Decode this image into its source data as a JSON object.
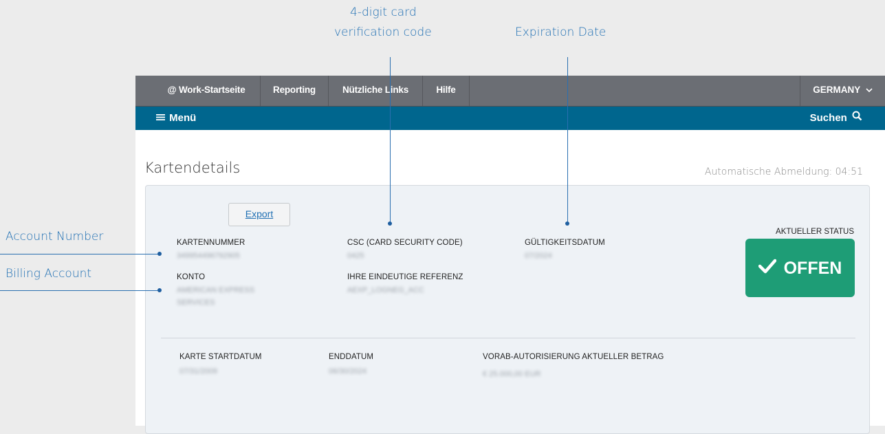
{
  "callouts": {
    "cvc_line1": "4-digit card",
    "cvc_line2": "verification code",
    "expiration": "Expiration Date",
    "account_number": "Account Number",
    "billing_account": "Billing Account"
  },
  "topnav": {
    "items": [
      "@ Work-Startseite",
      "Reporting",
      "Nützliche Links",
      "Hilfe"
    ],
    "country": "GERMANY",
    "country_icon": "chevron-down-icon"
  },
  "menubar": {
    "menu_label": "Menü",
    "menu_icon": "hamburger-icon",
    "search_label": "Suchen",
    "search_icon": "search-icon"
  },
  "auto_logout": "Automatische Abmeldung: 04:51",
  "page_title": "Kartendetails",
  "export_label": "Export",
  "fields": {
    "card_number": {
      "label": "KARTENNUMMER",
      "value": "349954496792905"
    },
    "account": {
      "label": "KONTO",
      "value_line1": "AMERICAN EXPRESS",
      "value_line2": "SERVICES"
    },
    "csc": {
      "label": "CSC (CARD SECURITY CODE)",
      "value": "0425"
    },
    "reference": {
      "label": "IHRE EINDEUTIGE REFERENZ",
      "value": "AEXP_LOGNEG_ACC"
    },
    "expiry": {
      "label": "GÜLTIGKEITSDATUM",
      "value": "07/2024"
    },
    "start_date": {
      "label": "KARTE STARTDATUM",
      "value": "07/31/2009"
    },
    "end_date": {
      "label": "ENDDATUM",
      "value": "06/30/2024"
    },
    "preauth": {
      "label": "VORAB-AUTORISIERUNG AKTUELLER BETRAG",
      "value": "€ 25.000,00 EUR"
    }
  },
  "status": {
    "label": "AKTUELLER STATUS",
    "value": "OFFEN",
    "icon": "checkmark-icon",
    "color": "#1e9d76"
  },
  "colors": {
    "accent": "#00668e",
    "callout": "#1f6fb3",
    "topnav": "#6b6e74"
  }
}
